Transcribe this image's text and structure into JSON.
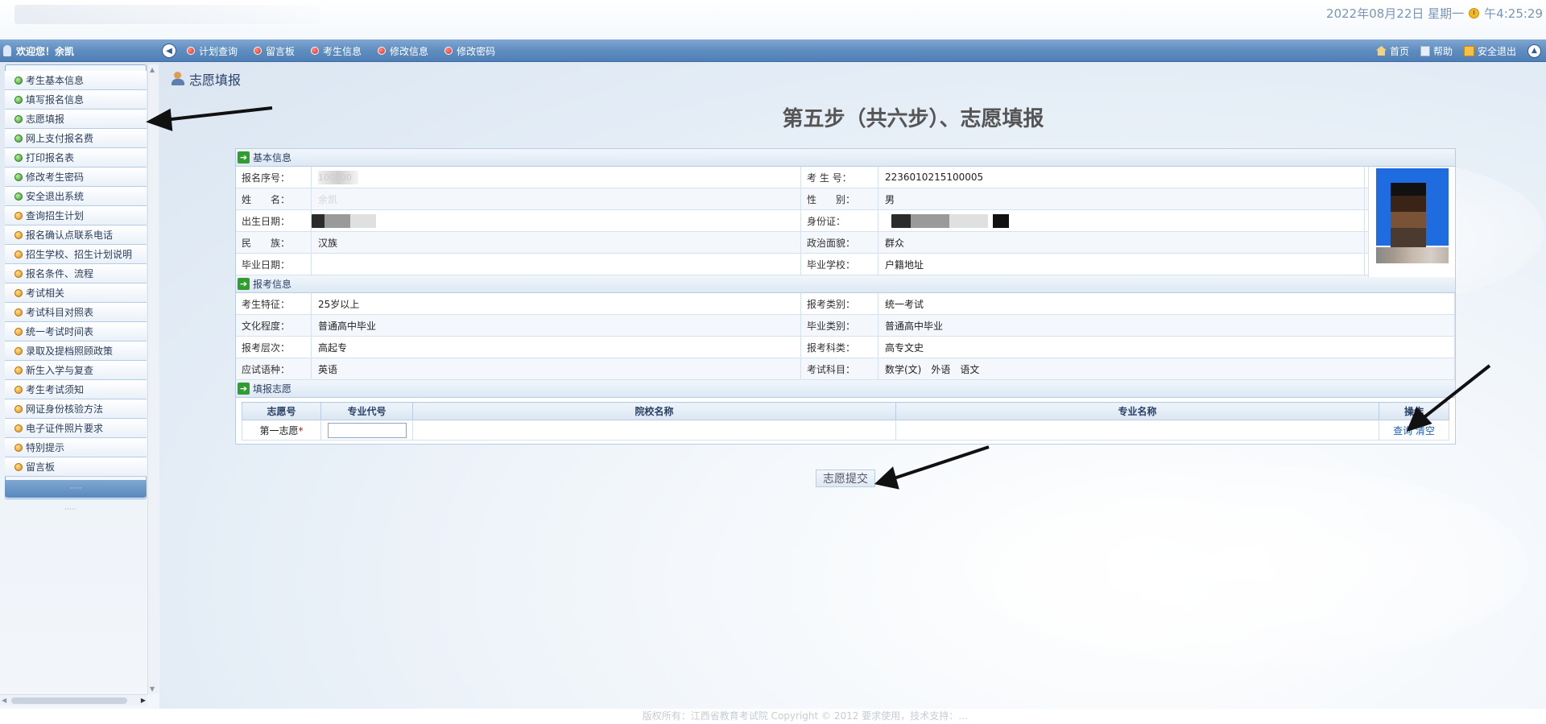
{
  "header": {
    "datetime": "2022年08月22日 星期一",
    "time": "午4:25:29"
  },
  "nav": {
    "welcome": "欢迎您！余凯",
    "menu": [
      {
        "label": "计划查询"
      },
      {
        "label": "留言板"
      },
      {
        "label": "考生信息"
      },
      {
        "label": "修改信息"
      },
      {
        "label": "修改密码"
      }
    ],
    "right": {
      "home": "首页",
      "help": "帮助",
      "logout": "安全退出"
    }
  },
  "sidebar": {
    "items": [
      {
        "label": "考生基本信息",
        "icon": "green-dot-icon"
      },
      {
        "label": "填写报名信息",
        "icon": "green-dot-icon"
      },
      {
        "label": "志愿填报",
        "icon": "green-dot-icon"
      },
      {
        "label": "网上支付报名费",
        "icon": "green-dot-icon"
      },
      {
        "label": "打印报名表",
        "icon": "green-dot-icon"
      },
      {
        "label": "修改考生密码",
        "icon": "green-dot-icon"
      },
      {
        "label": "安全退出系统",
        "icon": "green-dot-icon"
      },
      {
        "label": "查询招生计划",
        "icon": "orange-dot-icon"
      },
      {
        "label": "报名确认点联系电话",
        "icon": "orange-dot-icon"
      },
      {
        "label": "招生学校、招生计划说明",
        "icon": "orange-dot-icon"
      },
      {
        "label": "报名条件、流程",
        "icon": "orange-dot-icon"
      },
      {
        "label": "考试相关",
        "icon": "orange-dot-icon"
      },
      {
        "label": "考试科目对照表",
        "icon": "orange-dot-icon"
      },
      {
        "label": "统一考试时间表",
        "icon": "orange-dot-icon"
      },
      {
        "label": "录取及提档照顾政策",
        "icon": "orange-dot-icon"
      },
      {
        "label": "新生入学与复查",
        "icon": "orange-dot-icon"
      },
      {
        "label": "考生考试须知",
        "icon": "orange-dot-icon"
      },
      {
        "label": "网证身份核验方法",
        "icon": "orange-dot-icon"
      },
      {
        "label": "电子证件照片要求",
        "icon": "orange-dot-icon"
      },
      {
        "label": "特别提示",
        "icon": "orange-dot-icon"
      },
      {
        "label": "留言板",
        "icon": "orange-dot-icon"
      }
    ]
  },
  "main": {
    "page_title": "志愿填报",
    "step_title": "第五步（共六步）、志愿填报",
    "basic_section": "基本信息",
    "basic": {
      "reg_no_label": "报名序号：",
      "reg_no_value": "100000",
      "exam_no_label": "考 生 号：",
      "exam_no_value": "2236010215100005",
      "name_label": "姓　　名：",
      "name_value": "余凯",
      "gender_label": "性　　别：",
      "gender_value": "男",
      "birth_label": "出生日期：",
      "id_label": "身份证：",
      "ethnic_label": "民　　族：",
      "ethnic_value": "汉族",
      "political_label": "政治面貌：",
      "political_value": "群众",
      "grad_date_label": "毕业日期：",
      "grad_date_value": "",
      "grad_school_label": "毕业学校：",
      "grad_school_value": "户籍地址"
    },
    "apply_section": "报考信息",
    "apply": {
      "feature_label": "考生特征：",
      "feature_value": "25岁以上",
      "category_label": "报考类别：",
      "category_value": "统一考试",
      "education_label": "文化程度：",
      "education_value": "普通高中毕业",
      "grad_type_label": "毕业类别：",
      "grad_type_value": "普通高中毕业",
      "level_label": "报考层次：",
      "level_value": "高起专",
      "subject_type_label": "报考科类：",
      "subject_type_value": "高专文史",
      "language_label": "应试语种：",
      "language_value": "英语",
      "subjects_label": "考试科目：",
      "subjects_value": "数学(文)　外语　语文"
    },
    "vol_section": "填报志愿",
    "vol_table": {
      "headers": [
        "志愿号",
        "专业代号",
        "院校名称",
        "专业名称",
        "操作"
      ],
      "row_label": "第一志愿",
      "required_mark": "*",
      "op_query": "查询",
      "op_clear": "清空"
    },
    "submit_label": "志愿提交"
  },
  "footer": {
    "text": "版权所有：江西省教育考试院 Copyright © 2012 要求使用，技术支持：…"
  }
}
